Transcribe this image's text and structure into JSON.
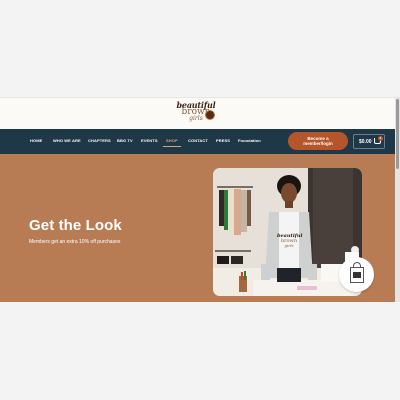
{
  "logo": {
    "line1": "beautiful",
    "line2": "brown",
    "line3": "girls"
  },
  "nav": {
    "items": [
      "HOME",
      "WHO WE ARE",
      "CHAPTERS",
      "BBG TV",
      "EVENTS",
      "SHOP",
      "CONTACT",
      "PRESS",
      "Foundation"
    ],
    "active": "SHOP",
    "cta_line1": "Become a",
    "cta_line2": "member/login",
    "cart_amount": "$0.00",
    "cart_count": "0"
  },
  "hero": {
    "title": "Get the Look",
    "subtitle": "Members get an extra 10% off purchases"
  },
  "photo": {
    "shirt_line1": "beautiful",
    "shirt_line2": "brown",
    "shirt_line3": "girls"
  },
  "colors": {
    "nav_bg": "#1f3848",
    "accent": "#b5552c",
    "hero_bg": "#b87c55",
    "active_link": "#d9a37a"
  },
  "icons": {
    "cart": "shopping-cart-icon",
    "tote": "tote-bag-icon"
  }
}
